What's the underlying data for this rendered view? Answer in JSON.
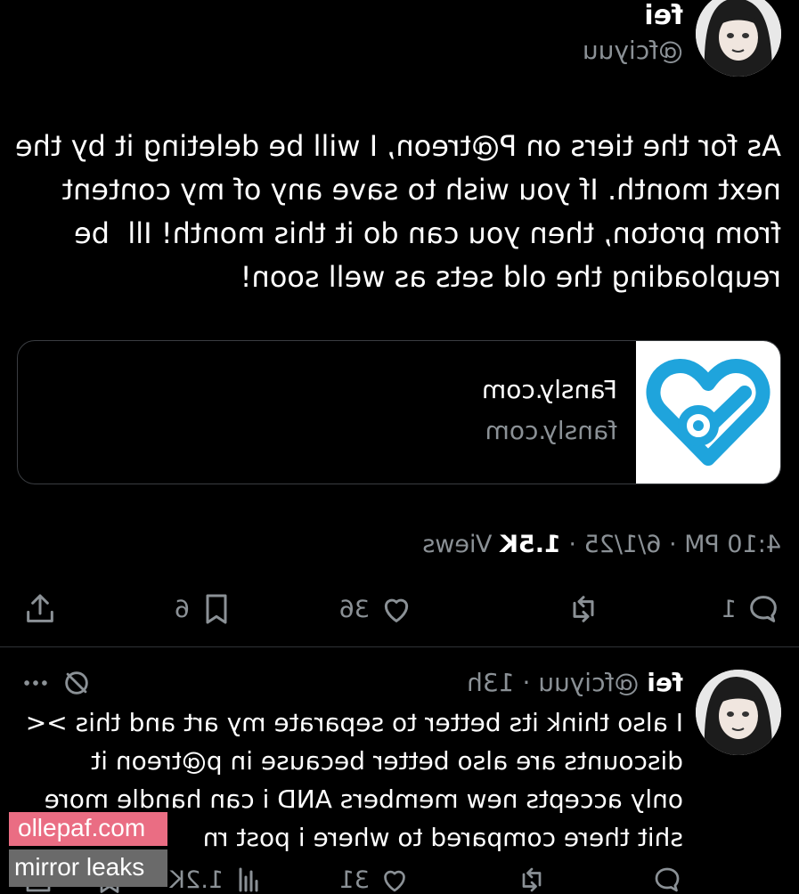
{
  "post1": {
    "author_name": "fei",
    "author_handle": "@fciyuu",
    "body": "As for the tiers on P@treon, I will be deleting it by the\nnext month. If you wish to save any of my content\nfrom proton, then you can do it this month! Ill  be\nreuploading the old sets as well soon!",
    "link_card": {
      "title": "Fansly.com",
      "domain": "fansly.com"
    },
    "meta": {
      "time": "4:10 PM · 6/1/25 ·",
      "views_count": "1.5K",
      "views_label": "Views"
    },
    "actions": {
      "replies": "1",
      "likes": "36",
      "bookmarks": "6"
    }
  },
  "post2": {
    "author_name": "fei",
    "author_handle": "@fciyuu · 13h",
    "body": "I also think its better to separate my art and this ><\ndiscounts are also better because in p@treon it\nonly accepts new members AND i can handle more\nshit there compared to where i post rn",
    "actions": {
      "likes": "31",
      "views": "1.2K"
    }
  },
  "watermark": {
    "line1": "ollepaf.com",
    "line2": "mirror leaks"
  },
  "colors": {
    "background": "#000000",
    "muted_text": "#8b9196",
    "fansly_blue": "#1fa4dc",
    "watermark_pink": "#ea6d83",
    "watermark_gray": "#6a6a6a"
  },
  "icons": [
    "reply-icon",
    "repost-icon",
    "like-icon",
    "bookmark-icon",
    "share-icon",
    "views-icon",
    "grok-icon",
    "more-icon"
  ]
}
